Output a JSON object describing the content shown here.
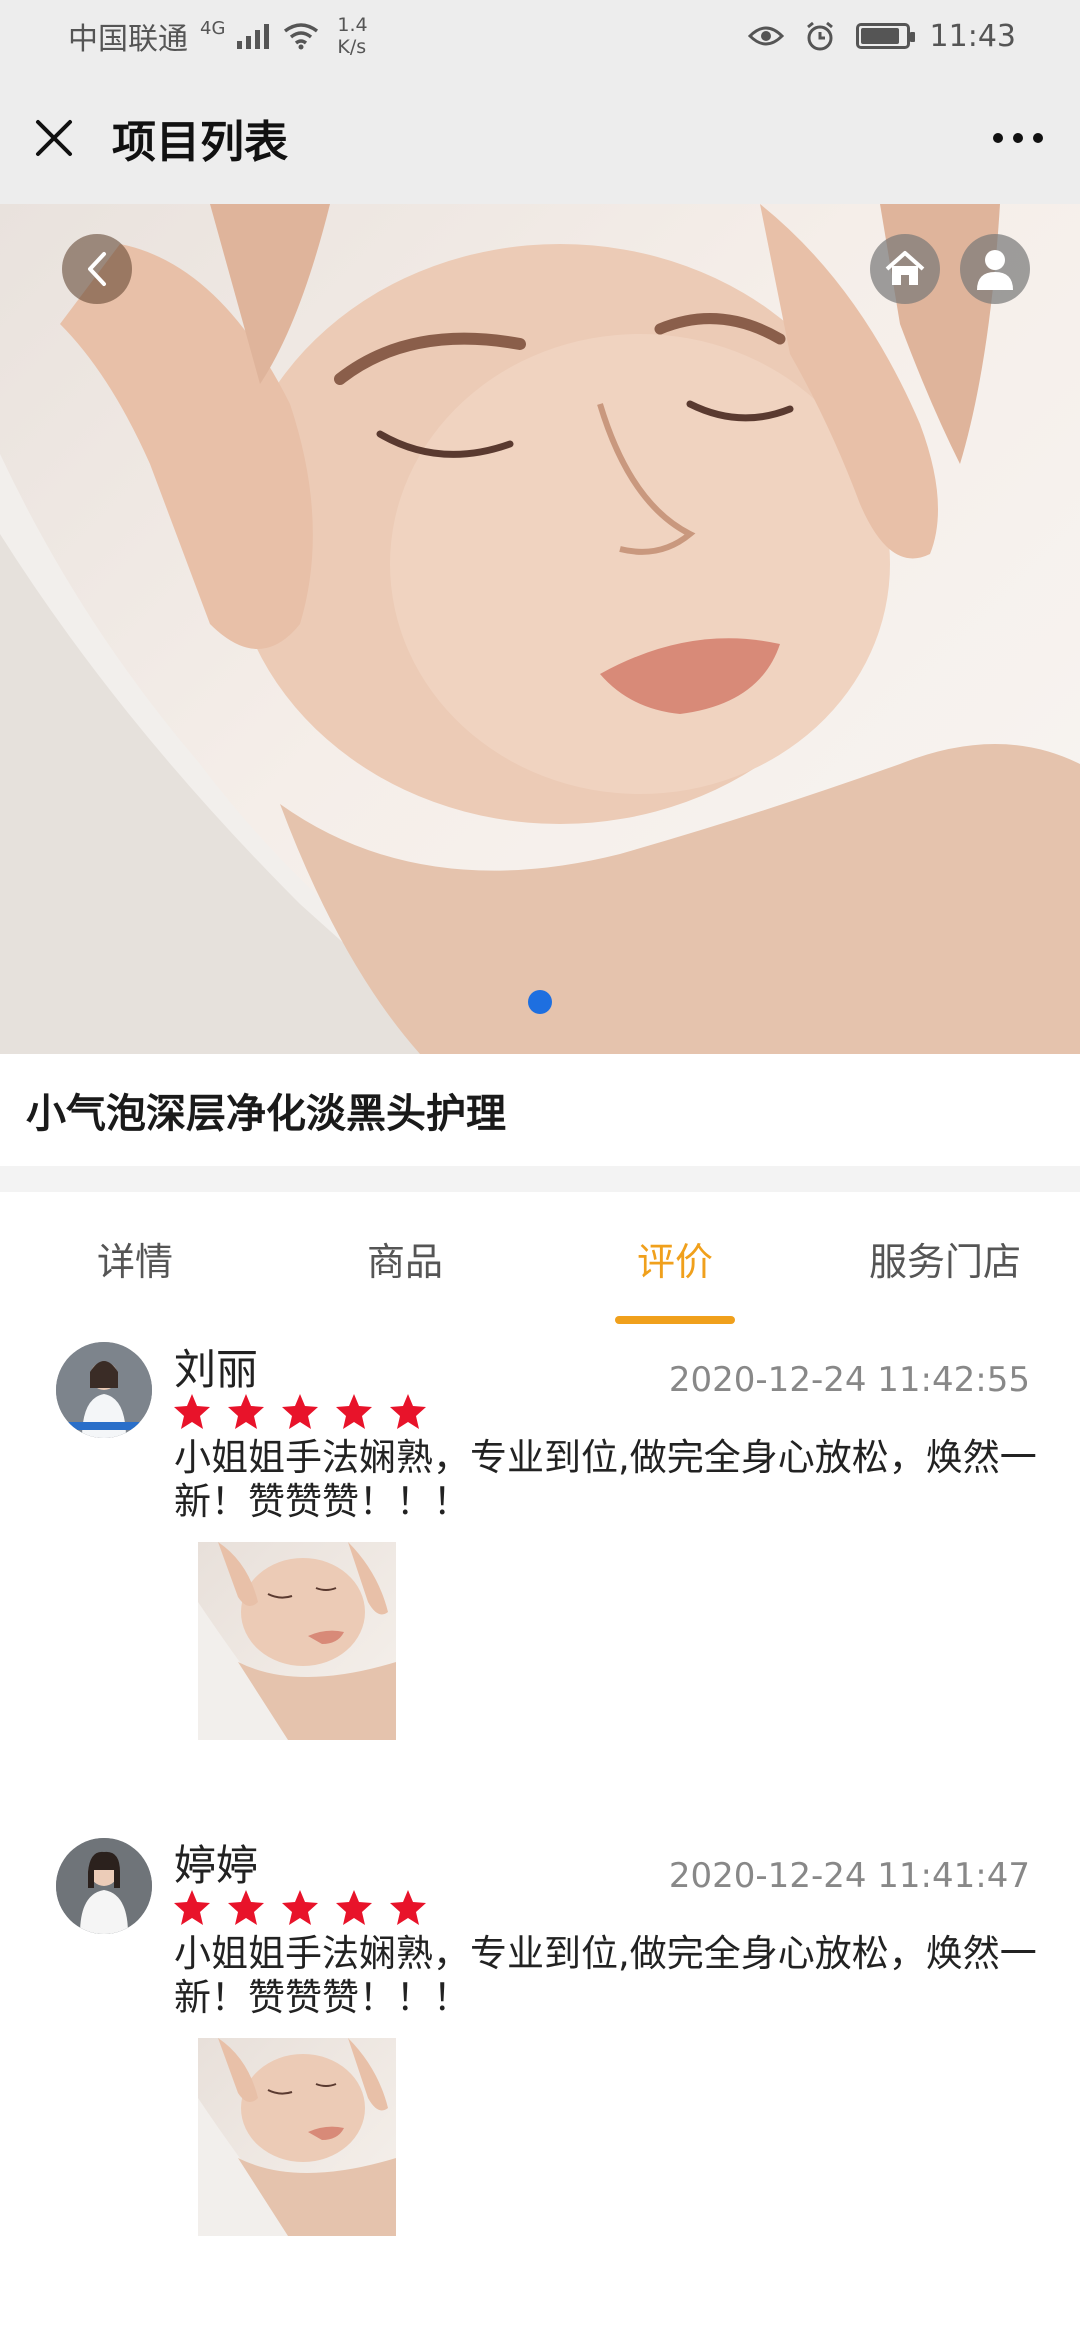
{
  "status_bar": {
    "carrier": "中国联通",
    "network": "4G",
    "speed_value": "1.4",
    "speed_unit": "K/s",
    "time": "11:43"
  },
  "title_bar": {
    "title": "项目列表"
  },
  "banner": {
    "slides": 1,
    "active_slide": 1
  },
  "product": {
    "title": "小气泡深层净化淡黑头护理"
  },
  "tabs": [
    {
      "label": "详情",
      "active": false
    },
    {
      "label": "商品",
      "active": false
    },
    {
      "label": "评价",
      "active": true
    },
    {
      "label": "服务门店",
      "active": false
    }
  ],
  "reviews": [
    {
      "name": "刘丽",
      "time": "2020-12-24 11:42:55",
      "rating": 5,
      "text": "小姐姐手法娴熟，专业到位,做完全身心放松，焕然一新！赞赞赞！！！"
    },
    {
      "name": "婷婷",
      "time": "2020-12-24 11:41:47",
      "rating": 5,
      "text": "小姐姐手法娴熟，专业到位,做完全身心放松，焕然一新！赞赞赞！！！"
    }
  ],
  "colors": {
    "accent": "#f0a01c",
    "star": "#e8132a",
    "indicator": "#1e6fe0"
  },
  "icons": {
    "close": "close-icon",
    "more": "more-icon",
    "back": "back-icon",
    "home": "home-icon",
    "user": "user-icon",
    "star": "star-icon"
  }
}
